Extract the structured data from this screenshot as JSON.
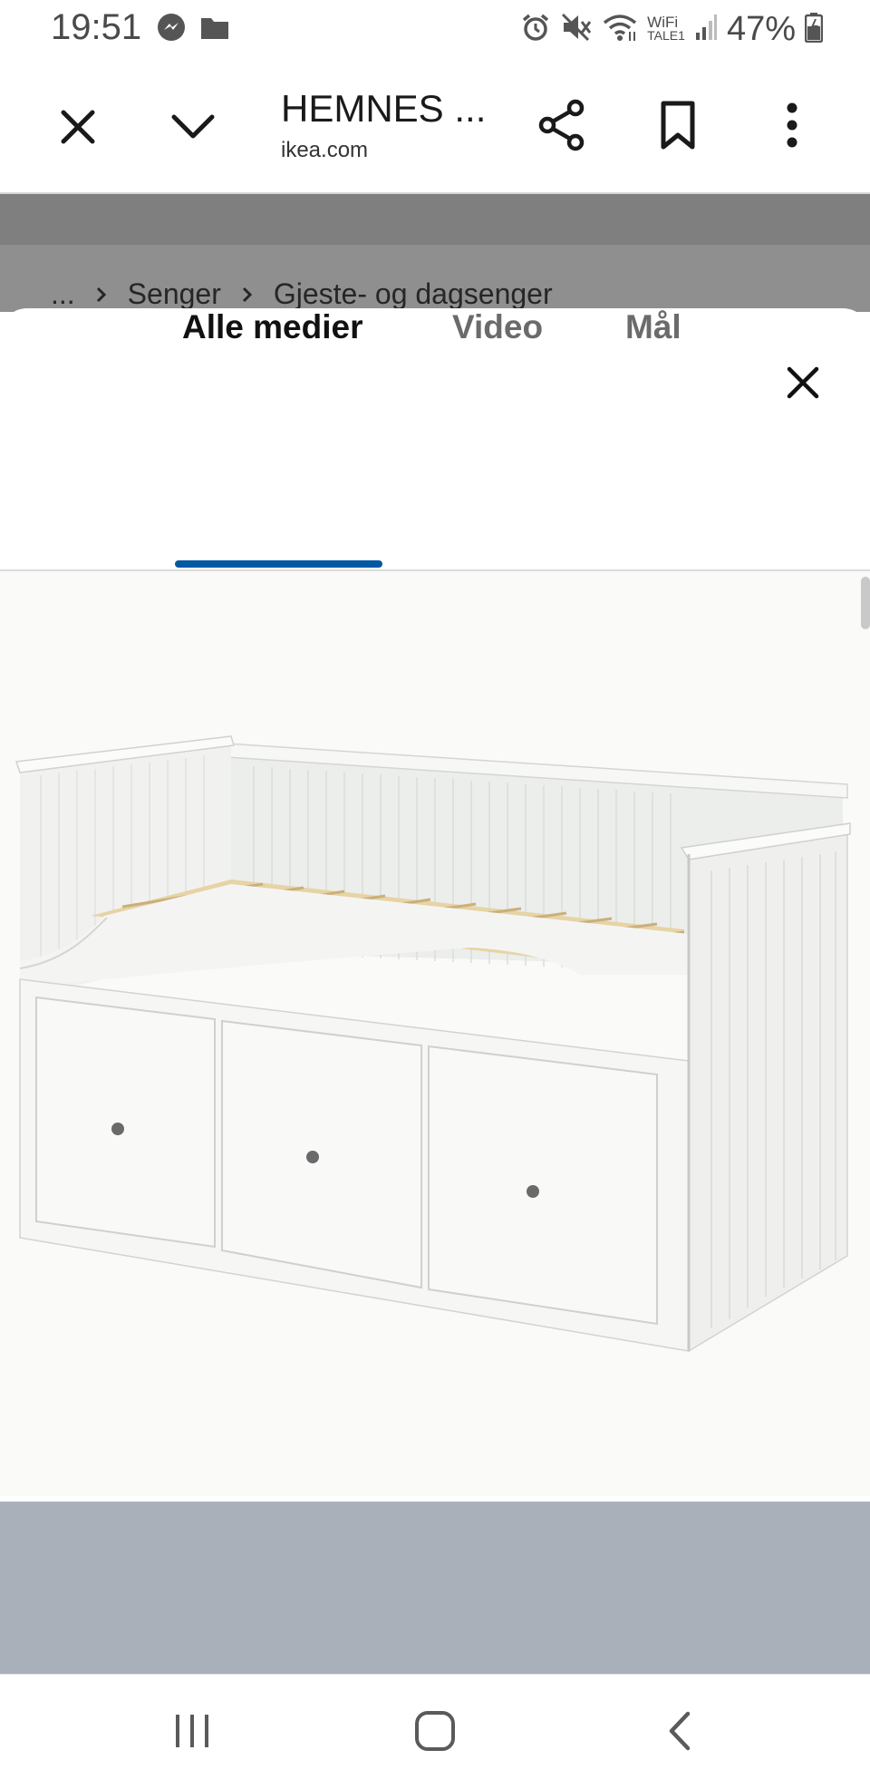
{
  "status_bar": {
    "time": "19:51",
    "wifi_label_top": "WiFi",
    "wifi_label_bottom": "TALE1",
    "battery_percent": "47%",
    "icons": [
      "messenger-icon",
      "folder-icon",
      "alarm-icon",
      "mute-icon",
      "wifi-icon",
      "signal-icon",
      "battery-icon"
    ]
  },
  "custom_tab": {
    "title": "HEMNES ...",
    "url": "ikea.com",
    "icons": [
      "close-icon",
      "chevron-down-icon",
      "share-icon",
      "bookmark-icon",
      "more-vert-icon"
    ]
  },
  "background_page": {
    "breadcrumb": [
      "...",
      "Senger",
      "Gjeste- og dagsenger"
    ]
  },
  "media_modal": {
    "tabs": [
      {
        "label": "Alle medier",
        "active": true
      },
      {
        "label": "Video",
        "active": false
      },
      {
        "label": "Mål",
        "active": false
      }
    ],
    "accent_color": "#0058a3",
    "image_subject": "white daybed with three drawers"
  },
  "nav_bar": {
    "icons": [
      "recents-icon",
      "home-icon",
      "back-icon"
    ]
  }
}
